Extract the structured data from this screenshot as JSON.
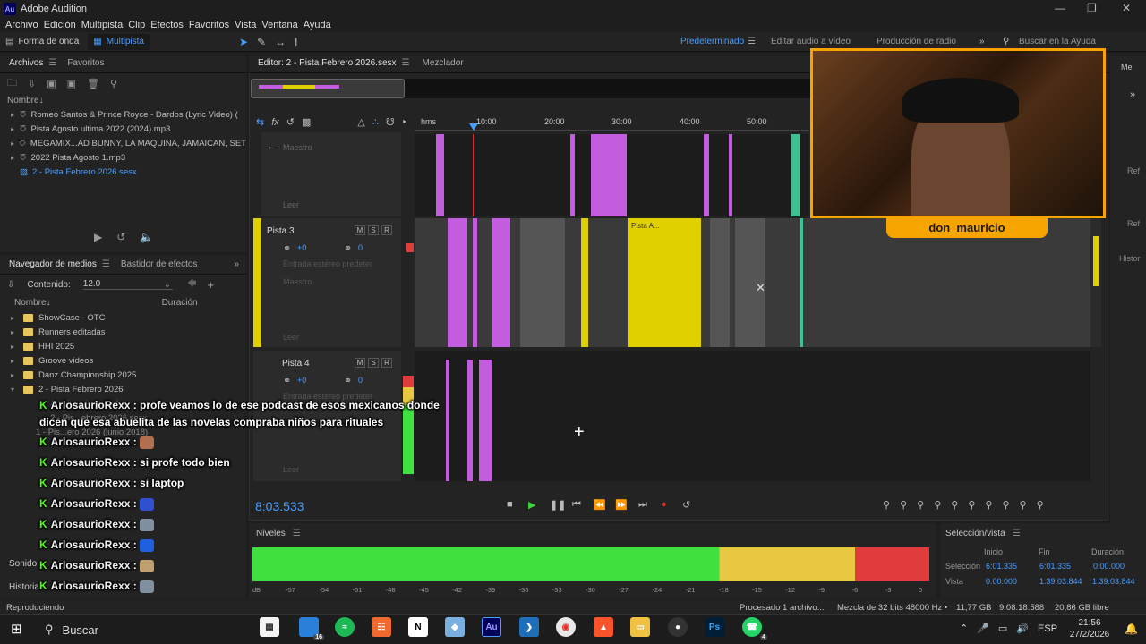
{
  "app": {
    "title": "Adobe Audition",
    "logo": "Au"
  },
  "menu": [
    "Archivo",
    "Edición",
    "Multipista",
    "Clip",
    "Efectos",
    "Favoritos",
    "Vista",
    "Ventana",
    "Ayuda"
  ],
  "toolbar": {
    "waveform": "Forma de onda",
    "multitrack": "Multipista"
  },
  "workspaces": {
    "default": "Predeterminado",
    "edit_video": "Editar audio a vídeo",
    "radio": "Producción de radio",
    "search": "Buscar en la Ayuda"
  },
  "files_panel": {
    "tab_files": "Archivos",
    "tab_favorites": "Favoritos",
    "col_name": "Nombre",
    "items": [
      "Romeo Santos & Prince Royce - Dardos (Lyric Video) (",
      "Pista Agosto ultima 2022 (2024).mp3",
      "MEGAMIX...AD BUNNY, LA MAQUINA, JAMAICAN, SET",
      "2022 Pista Agosto 1.mp3",
      "2 - Pista Febrero 2026.sesx"
    ]
  },
  "media_panel": {
    "tab_media": "Navegador de medios",
    "tab_effects": "Bastidor de efectos",
    "content_label": "Contenido:",
    "content_value": "12.0",
    "col_name": "Nombre",
    "col_duration": "Duración",
    "items": [
      "ShowCase - OTC",
      "Runners editadas",
      "HHI 2025",
      "Groove videos",
      "Danz Championship 2025",
      "2 - Pista Febrero 2026"
    ],
    "sub_items": [
      "Archivos importados",
      "2 - Pis...ebrero 2026.sesx",
      "1 - Pis...ero 2026 (junio 2018)"
    ]
  },
  "editor": {
    "tab": "Editor: 2 - Pista Febrero 2026.sesx",
    "mixer": "Mezclador",
    "ruler": [
      "hms",
      "10:00",
      "20:00",
      "30:00",
      "40:00",
      "50:00"
    ],
    "track_master": "Maestro",
    "read": "Leer",
    "track3": {
      "name": "Pista 3",
      "vol": "+0",
      "pan": "0",
      "input": "Entrada estéreo predeter"
    },
    "track4": {
      "name": "Pista 4",
      "vol": "+0",
      "pan": "0",
      "input": "Entrada estéreo predeter"
    },
    "clip_label": "Pista A...",
    "time": "8:03.533"
  },
  "levels": {
    "title": "Niveles",
    "scale": [
      "dB",
      "-57",
      "-54",
      "-51",
      "-48",
      "-45",
      "-42",
      "-39",
      "-36",
      "-33",
      "-30",
      "-27",
      "-24",
      "-21",
      "-18",
      "-15",
      "-12",
      "-9",
      "-6",
      "-3",
      "0"
    ]
  },
  "selection": {
    "title": "Selección/vista",
    "col_start": "Inicio",
    "col_end": "Fin",
    "col_dur": "Duración",
    "sel_label": "Selección",
    "sel_start": "6:01.335",
    "sel_end": "6:01.335",
    "sel_dur": "0:00.000",
    "view_label": "Vista",
    "view_start": "0:00.000",
    "view_end": "1:39:03.844",
    "view_dur": "1:39:03.844"
  },
  "webcam": {
    "name": "don_mauricio"
  },
  "right_strip": [
    "Me",
    "Ref",
    "Ref",
    "Histor"
  ],
  "left_bottom": [
    "Sonido",
    "Historia"
  ],
  "status": {
    "left": "Reproduciendo",
    "processed": "Procesado 1 archivo...",
    "format": "Mezcla de 32 bits 48000 Hz •",
    "size": "11,77 GB",
    "duration": "9:08:18.588",
    "free": "20,86 GB libre"
  },
  "chat": [
    {
      "user": "ArlosaurioRexx",
      "msg": ": profe veamos lo de ese podcast de esos mexicanos donde"
    },
    {
      "user": "",
      "msg": "dicen que esa abuelita de las novelas compraba niños para rituales"
    },
    {
      "user": "ArlosaurioRexx",
      "msg": ":"
    },
    {
      "user": "ArlosaurioRexx",
      "msg": ": si profe todo bien"
    },
    {
      "user": "ArlosaurioRexx",
      "msg": ": si laptop"
    },
    {
      "user": "ArlosaurioRexx",
      "msg": ":"
    },
    {
      "user": "ArlosaurioRexx",
      "msg": ":"
    },
    {
      "user": "ArlosaurioRexx",
      "msg": ":"
    },
    {
      "user": "ArlosaurioRexx",
      "msg": ":"
    },
    {
      "user": "ArlosaurioRexx",
      "msg": ":"
    }
  ],
  "taskbar": {
    "search": "Buscar",
    "lang": "ESP",
    "time": "21:56",
    "date": "27/2/2026",
    "badge1": "16",
    "badge2": "4"
  },
  "colors": {
    "accent": "#4a9eff",
    "purple": "#c45ce0",
    "yellow": "#e0d000",
    "green": "#40e040",
    "meter_yellow": "#e8c840",
    "meter_red": "#e03c3c",
    "chat_kick": "#53fc18"
  }
}
